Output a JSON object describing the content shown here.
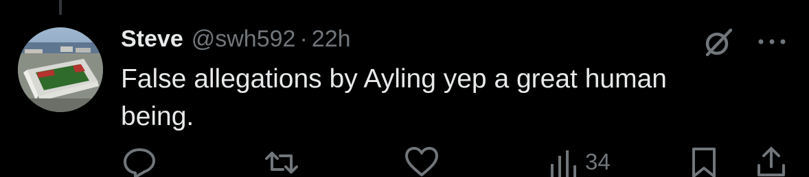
{
  "tweet": {
    "author": {
      "display_name": "Steve",
      "handle": "@swh592",
      "avatar": "stadium-aerial-photo"
    },
    "separator": "·",
    "time": "22h",
    "text": "False allegations by Ayling yep a great human being."
  },
  "actions": {
    "reply": {
      "icon": "reply-icon"
    },
    "retweet": {
      "icon": "retweet-icon"
    },
    "like": {
      "icon": "like-icon"
    },
    "views": {
      "icon": "views-icon",
      "count": "34"
    },
    "bookmark": {
      "icon": "bookmark-icon"
    },
    "share": {
      "icon": "share-icon"
    }
  },
  "header_icons": {
    "grok": "grok-icon",
    "more": "more-icon"
  },
  "colors": {
    "background": "#000000",
    "primary_text": "#e7e9ea",
    "secondary_text": "#71767b"
  }
}
